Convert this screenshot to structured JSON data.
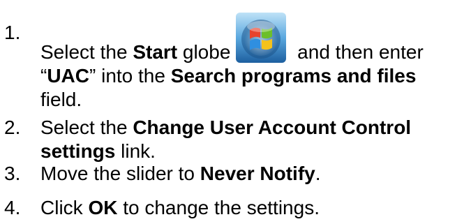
{
  "steps": [
    {
      "number": "1.",
      "pre": "Select the ",
      "b1": "Start",
      "mid1": " globe",
      "mid2": " and then enter",
      "q_open": "“",
      "b2": "UAC",
      "q_close": "”",
      "mid3": " into the ",
      "b3": "Search programs and files",
      "post": "field."
    },
    {
      "number": "2.",
      "pre": "Select the ",
      "b1": "Change User Account Control settings",
      "post": " link."
    },
    {
      "number": "3.",
      "pre": "Move the slider to ",
      "b1": "Never Notify",
      "post": "."
    },
    {
      "number": "4.",
      "pre": "Click ",
      "b1": "OK",
      "post": " to change the settings."
    }
  ],
  "icons": {
    "start_orb": "windows-start-orb-icon"
  },
  "colors": {
    "orb_glass_top": "#9fd0ef",
    "orb_glass_bottom": "#2a78b8",
    "flag_red": "#e8432c",
    "flag_green": "#6cbf2a",
    "flag_blue": "#2f8fe0",
    "flag_yellow": "#f5c21b"
  }
}
